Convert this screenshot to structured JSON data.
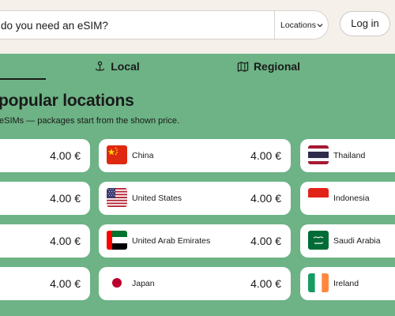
{
  "search": {
    "text": "do you need an eSIM?"
  },
  "locations_select": {
    "label": "Locations"
  },
  "header": {
    "login_label": "Log in"
  },
  "tabs": [
    {
      "label": "Local",
      "icon": "anchor-pin-icon",
      "active": true
    },
    {
      "label": "Regional",
      "icon": "map-icon",
      "active": false
    }
  ],
  "section": {
    "title": "popular locations",
    "subtitle": "eSIMs — packages start from the shown price."
  },
  "col_left": [
    {
      "price": "4.00 €"
    },
    {
      "price": "4.00 €"
    },
    {
      "price": "4.00 €"
    },
    {
      "price": "4.00 €"
    }
  ],
  "col_mid": [
    {
      "name": "China",
      "price": "4.00 €",
      "flag": "cn-flag-icon"
    },
    {
      "name": "United States",
      "price": "4.00 €",
      "flag": "us-flag-icon"
    },
    {
      "name": "United Arab Emirates",
      "price": "4.00 €",
      "flag": "ae-flag-icon"
    },
    {
      "name": "Japan",
      "price": "4.00 €",
      "flag": "jp-flag-icon"
    }
  ],
  "col_right": [
    {
      "name": "Thailand",
      "flag": "th-flag-icon"
    },
    {
      "name": "Indonesia",
      "flag": "id-flag-icon"
    },
    {
      "name": "Saudi Arabia",
      "flag": "sa-flag-icon"
    },
    {
      "name": "Ireland",
      "flag": "ie-flag-icon"
    }
  ],
  "colors": {
    "background": "#6db385",
    "header": "#f6f0eb",
    "card": "#ffffff",
    "text": "#1a1a1a"
  }
}
